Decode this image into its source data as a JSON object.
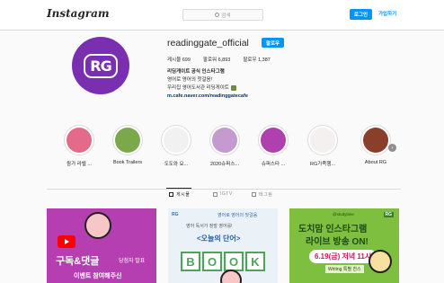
{
  "topbar": {
    "logo": "Instagram",
    "search_placeholder": "검색",
    "login_label": "로그인",
    "signup_label": "가입하기"
  },
  "profile": {
    "username": "readinggate_official",
    "follow_label": "팔로우",
    "stats": {
      "posts": "게시물 699",
      "followers": "팔로워 6,893",
      "following": "팔로우 1,387"
    },
    "bio": {
      "name": "리딩게이트 공식 인스타그램",
      "line1": "영어로 영어의 첫걸음!",
      "line2": "우리집 영어도서관 리딩게이트",
      "link": "m.cafe.naver.com/readinggatecafe"
    },
    "avatar_text": "RG",
    "avatar_color": "#7a2fb0"
  },
  "highlights": [
    {
      "label": "윙가 라벨 ...",
      "color": "#e46a8a"
    },
    {
      "label": "Book Trailers",
      "color": "#7aa84a"
    },
    {
      "label": "도도와 요...",
      "color": "#f1f1f1"
    },
    {
      "label": "2020슈퍼스...",
      "color": "#c49ad0"
    },
    {
      "label": "슈퍼스타 ...",
      "color": "#b03fb0"
    },
    {
      "label": "RG가족행...",
      "color": "#f5f0f0"
    },
    {
      "label": "About RG",
      "color": "#8a3f2a"
    }
  ],
  "tabs": {
    "posts": "게시물",
    "igtv": "IGTV",
    "tagged": "태그됨"
  },
  "posts": {
    "p1": {
      "title": "구독&댓글",
      "badge": "당첨자 발표",
      "sub": "이벤트 참여해주신"
    },
    "p2": {
      "logo": "RG",
      "top": "영어로 영어의 첫걸음",
      "sub": "영어 독서가 정말 영어를!",
      "title": "<오늘의 단어>",
      "letters": [
        "B",
        "O",
        "O",
        "K"
      ]
    },
    "p3": {
      "handle": "@studytime",
      "rg": "RG",
      "title1": "도치맘 인스타그램",
      "title2": "라이브 방송 ON!",
      "date": "6.19(금) 저녁 11시",
      "wm": "Writing 특별 찬스"
    }
  }
}
